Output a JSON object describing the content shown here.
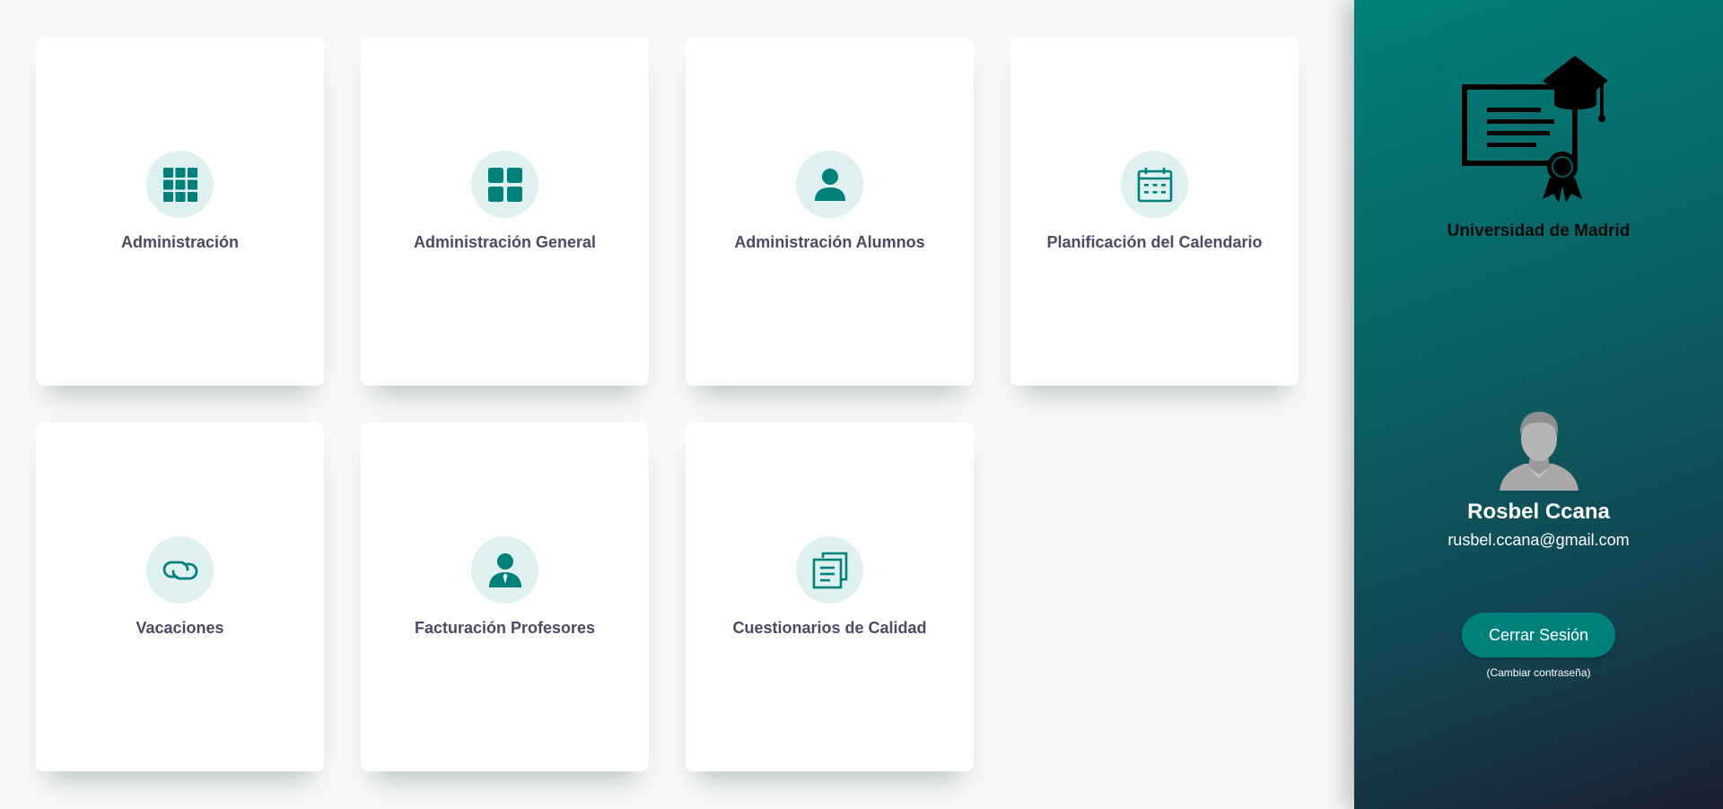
{
  "modules": [
    {
      "label": "Administración",
      "icon": "grid-icon"
    },
    {
      "label": "Administración General",
      "icon": "dashboard-icon"
    },
    {
      "label": "Administración Alumnos",
      "icon": "user-icon"
    },
    {
      "label": "Planificación del Calendario",
      "icon": "calendar-icon"
    },
    {
      "label": "Vacaciones",
      "icon": "link-icon"
    },
    {
      "label": "Facturación Profesores",
      "icon": "user-tie-icon"
    },
    {
      "label": "Cuestionarios de Calidad",
      "icon": "documents-icon"
    }
  ],
  "sidebar": {
    "university_name": "Universidad de Madrid",
    "user_name": "Rosbel Ccana",
    "user_email": "rusbel.ccana@gmail.com",
    "logout_label": "Cerrar Sesión",
    "change_password_label": "(Cambiar contraseña)"
  },
  "colors": {
    "accent": "#00807a",
    "icon_bg": "#dff0f0",
    "label_text": "#4b4a63",
    "sidebar_gradient_start": "#00807a",
    "sidebar_gradient_end": "#1c1f33"
  }
}
